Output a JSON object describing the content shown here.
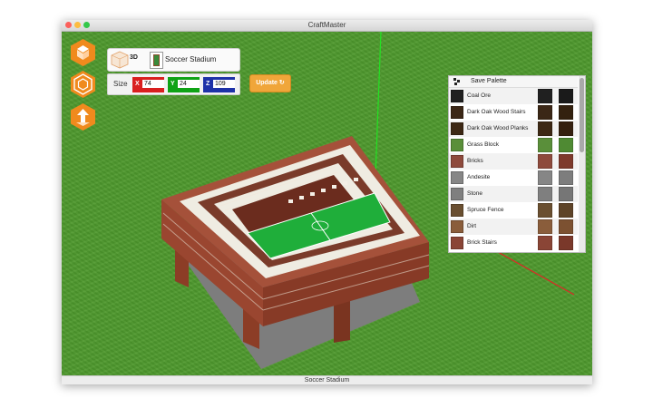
{
  "window": {
    "title": "CraftMaster"
  },
  "toolbar": {
    "mode_label": "3D",
    "model_name": "Soccer Stadium",
    "size_label": "Size",
    "x_label": "X",
    "y_label": "Y",
    "z_label": "Z",
    "x_value": "74",
    "y_value": "24",
    "z_value": "109",
    "update_label": "Update",
    "accent": "#f0a63a"
  },
  "tools": [
    {
      "icon": "build-tool-icon"
    },
    {
      "icon": "layers-tool-icon"
    },
    {
      "icon": "move-tool-icon"
    }
  ],
  "palette": {
    "save_label": "Save Palette",
    "items": [
      {
        "label": "Coal Ore",
        "color": "#202020",
        "swatch2": "#1a1a1a"
      },
      {
        "label": "Dark Oak Wood Stairs",
        "color": "#3b2716",
        "swatch2": "#33210f"
      },
      {
        "label": "Dark Oak Wood Planks",
        "color": "#3d2814",
        "swatch2": "#35200f"
      },
      {
        "label": "Grass Block",
        "color": "#5a8f3a",
        "swatch2": "#4f8a33"
      },
      {
        "label": "Bricks",
        "color": "#8e4a3c",
        "swatch2": "#7e3a2c"
      },
      {
        "label": "Andesite",
        "color": "#868686",
        "swatch2": "#7d7d7d"
      },
      {
        "label": "Stone",
        "color": "#7f7f7f",
        "swatch2": "#767676"
      },
      {
        "label": "Spruce Fence",
        "color": "#6a4f30",
        "swatch2": "#5e4428"
      },
      {
        "label": "Dirt",
        "color": "#8a5d3b",
        "swatch2": "#7c5131"
      },
      {
        "label": "Brick Stairs",
        "color": "#8a4536",
        "swatch2": "#7a382a"
      }
    ]
  },
  "status": {
    "text": "Soccer Stadium"
  }
}
